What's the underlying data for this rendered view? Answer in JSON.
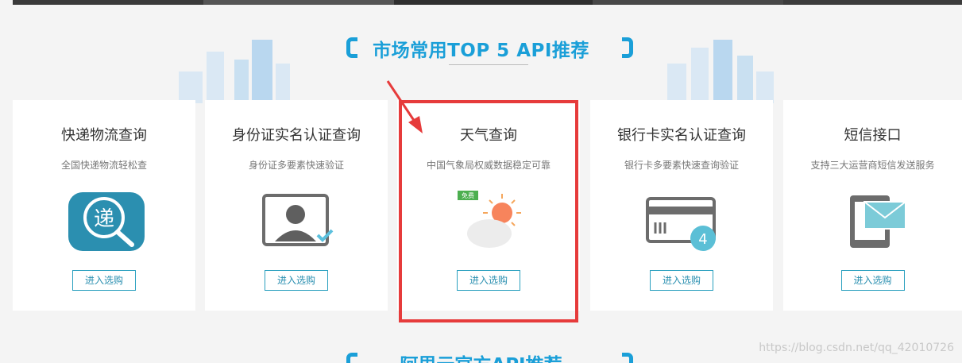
{
  "section": {
    "title": "市场常用TOP 5 API推荐"
  },
  "cards": [
    {
      "name": "快递物流查询",
      "desc": "全国快递物流轻松查",
      "button": "进入选购",
      "icon": "express-delivery-icon",
      "icon_text": "递"
    },
    {
      "name": "身份证实名认证查询",
      "desc": "身份证多要素快速验证",
      "button": "进入选购",
      "icon": "id-verify-icon"
    },
    {
      "name": "天气查询",
      "desc": "中国气象局权威数据稳定可靠",
      "button": "进入选购",
      "icon": "weather-icon",
      "badge": "免费"
    },
    {
      "name": "银行卡实名认证查询",
      "desc": "银行卡多要素快速查询验证",
      "button": "进入选购",
      "icon": "bank-card-icon",
      "icon_text": "4"
    },
    {
      "name": "短信接口",
      "desc": "支持三大运营商短信发送服务",
      "button": "进入选购",
      "icon": "sms-icon"
    }
  ],
  "next_section": {
    "title": "阿里云官方API推荐"
  },
  "watermark": "https://blog.csdn.net/qq_42010726",
  "colors": {
    "accent": "#1a9fd8",
    "highlight": "#e63b3b",
    "button_border": "#2aa0bf"
  }
}
